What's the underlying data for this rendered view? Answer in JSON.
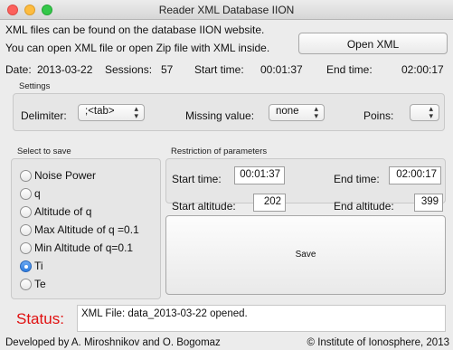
{
  "window": {
    "title": "Reader XML Database IION"
  },
  "info": {
    "line1": "XML files can be found on the database IION website.",
    "line2": "You can open XML file or open Zip file with XML inside."
  },
  "open_xml_label": "Open XML",
  "header": {
    "date_label": "Date:",
    "date_value": "2013-03-22",
    "sessions_label": "Sessions:",
    "sessions_value": "57",
    "start_label": "Start time:",
    "start_value": "00:01:37",
    "end_label": "End time:",
    "end_value": "02:00:17"
  },
  "settings": {
    "title": "Settings",
    "delimiter_label": "Delimiter:",
    "delimiter_value": ";<tab>",
    "missing_label": "Missing value:",
    "missing_value": "none",
    "poins_label": "Poins:",
    "poins_value": ""
  },
  "select_to_save": {
    "title": "Select to save",
    "options": [
      {
        "label": "Noise Power",
        "checked": false
      },
      {
        "label": "q",
        "checked": false
      },
      {
        "label": "Altitude of q",
        "checked": false
      },
      {
        "label": "Max Altitude of q =0.1",
        "checked": false
      },
      {
        "label": "Min Altitude of q=0.1",
        "checked": false
      },
      {
        "label": "Ti",
        "checked": true
      },
      {
        "label": "Te",
        "checked": false
      }
    ]
  },
  "restriction": {
    "title": "Restriction of parameters",
    "start_time_label": "Start time:",
    "start_time_value": "00:01:37",
    "end_time_label": "End time:",
    "end_time_value": "02:00:17",
    "start_alt_label": "Start altitude:",
    "start_alt_value": "202",
    "end_alt_label": "End altitude:",
    "end_alt_value": "399"
  },
  "save_label": "Save",
  "status": {
    "label": "Status:",
    "message": "XML File: data_2013-03-22 opened.",
    "color": "#e01010"
  },
  "footer": {
    "left": "Developed by A. Miroshnikov and O. Bogomaz",
    "right": "© Institute of Ionosphere, 2013"
  }
}
